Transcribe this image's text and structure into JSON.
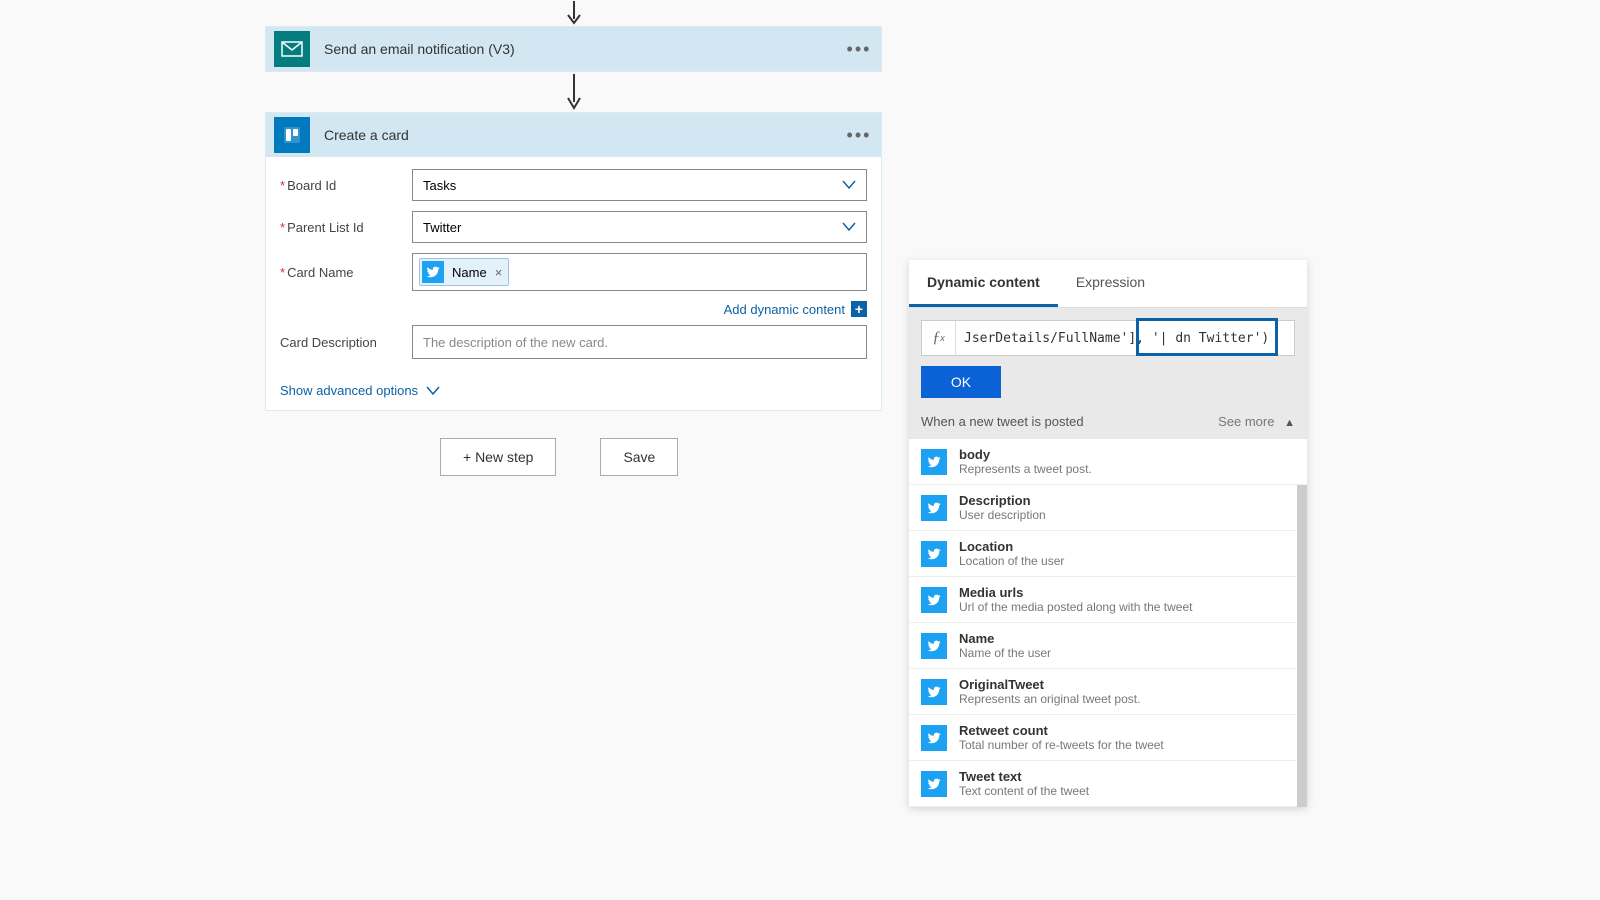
{
  "steps": {
    "email": {
      "title": "Send an email notification (V3)"
    },
    "trello": {
      "title": "Create a card"
    }
  },
  "trelloCard": {
    "boardLabel": "Board Id",
    "boardValue": "Tasks",
    "listLabel": "Parent List Id",
    "listValue": "Twitter",
    "nameLabel": "Card Name",
    "nameToken": "Name",
    "addDynamic": "Add dynamic content",
    "descLabel": "Card Description",
    "descPlaceholder": "The description of the new card.",
    "advanced": "Show advanced options"
  },
  "buttons": {
    "newStep": "+ New step",
    "save": "Save"
  },
  "dynPanel": {
    "tabs": {
      "dynamic": "Dynamic content",
      "expression": "Expression"
    },
    "expression": "JserDetails/FullName'], '| dn Twitter')",
    "ok": "OK",
    "sourceTitle": "When a new tweet is posted",
    "seeMore": "See more",
    "items": [
      {
        "title": "body",
        "desc": "Represents a tweet post."
      },
      {
        "title": "Description",
        "desc": "User description"
      },
      {
        "title": "Location",
        "desc": "Location of the user"
      },
      {
        "title": "Media urls",
        "desc": "Url of the media posted along with the tweet"
      },
      {
        "title": "Name",
        "desc": "Name of the user"
      },
      {
        "title": "OriginalTweet",
        "desc": "Represents an original tweet post."
      },
      {
        "title": "Retweet count",
        "desc": "Total number of re-tweets for the tweet"
      },
      {
        "title": "Tweet text",
        "desc": "Text content of the tweet"
      }
    ]
  }
}
